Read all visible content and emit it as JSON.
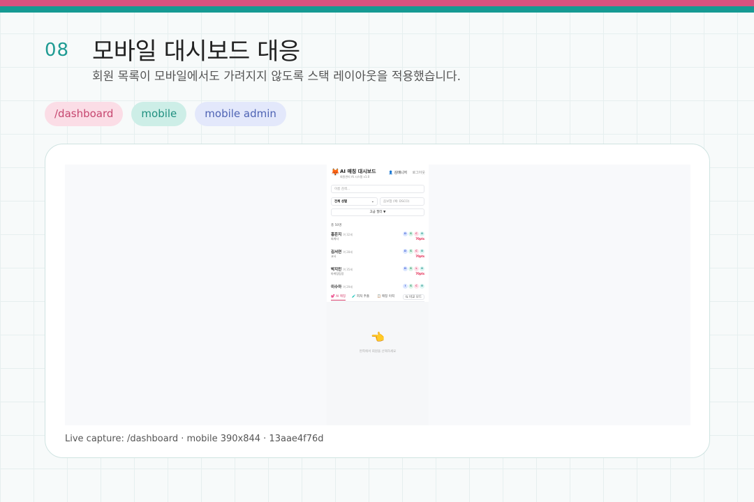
{
  "slide": {
    "number": "08",
    "title": "모바일 대시보드 대응",
    "subtitle": "회원 목록이 모바일에서도 가려지지 않도록 스택 레이아웃을 적용했습니다."
  },
  "chips": [
    {
      "label": "/dashboard"
    },
    {
      "label": "mobile"
    },
    {
      "label": "mobile admin"
    }
  ],
  "colors": {
    "accent_pink": "#d9527f",
    "accent_teal": "#169a93"
  },
  "capture": {
    "caption": "Live capture: /dashboard · mobile 390x844 · 13aae4f76d"
  },
  "mobile": {
    "logo_icon": "fox-icon",
    "app_title": "AI 매칭 대시보드",
    "version": "회원관리 AI 시스템 v1.0",
    "user": "👤 김매니저",
    "logout": "로그아웃",
    "search_placeholder": "이름 검색...",
    "gender_select": "전체 성별",
    "mbti_placeholder": "음보험 (예: DSCO)",
    "advanced_filter": "고급 필터 ▼",
    "count": "총 50명",
    "members": [
      {
        "name": "홍은지",
        "meta": "여 32세",
        "job": "회계사",
        "tags": [
          "D",
          "S",
          "C",
          "O"
        ],
        "points": "70pts"
      },
      {
        "name": "김서연",
        "meta": "여 28세",
        "job": "교사",
        "tags": [
          "D",
          "S",
          "C",
          "O"
        ],
        "points": "70pts"
      },
      {
        "name": "박지민",
        "meta": "여 35세",
        "job": "마케팅팀장",
        "tags": [
          "D",
          "S",
          "L",
          "O"
        ],
        "points": "70pts"
      },
      {
        "name": "이수아",
        "meta": "여 29세",
        "job": "",
        "tags": [
          "I",
          "S",
          "C",
          "O"
        ],
        "points": ""
      }
    ],
    "tabs": {
      "ai_matching": "💕 AI 매칭",
      "feature": "🧪 피처 추출",
      "history": "📋 매칭 이력",
      "compare": "⇆ 비교 모드"
    },
    "empty_hand": "👈",
    "empty_text": "왼쪽에서 회원을 선택하세요"
  }
}
